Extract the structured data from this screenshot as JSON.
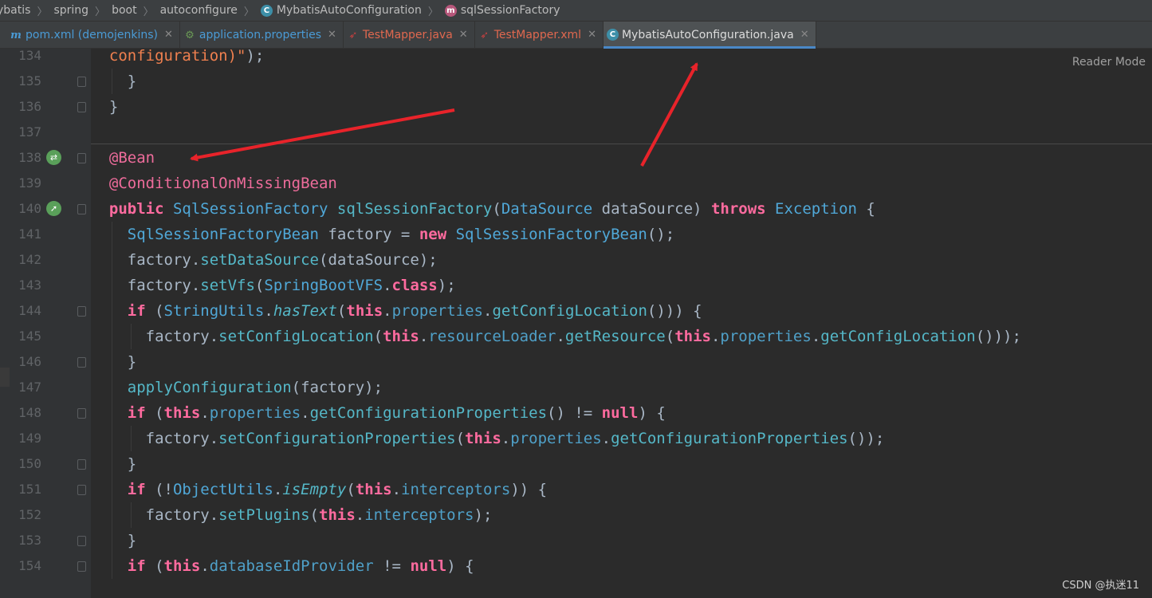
{
  "breadcrumb": {
    "items": [
      "ybatis",
      "spring",
      "boot",
      "autoconfigure",
      "MybatisAutoConfiguration",
      "sqlSessionFactory"
    ]
  },
  "tabs": [
    {
      "label": "pom.xml (demojenkins)",
      "icon": "maven-icon",
      "color": "#4a9bd6"
    },
    {
      "label": "application.properties",
      "icon": "spring-properties-icon",
      "color": "#4a9bd6"
    },
    {
      "label": "TestMapper.java",
      "icon": "mybatis-mapper-icon",
      "color": "#e0684f"
    },
    {
      "label": "TestMapper.xml",
      "icon": "mybatis-mapper-icon",
      "color": "#e0684f"
    },
    {
      "label": "MybatisAutoConfiguration.java",
      "icon": "class-icon",
      "color": "#dcdcdc",
      "active": true
    }
  ],
  "editor": {
    "reader_mode": "Reader Mode",
    "watermark": "CSDN @执迷11",
    "line_numbers": [
      "134",
      "135",
      "136",
      "137",
      "138",
      "139",
      "140",
      "141",
      "142",
      "143",
      "144",
      "145",
      "146",
      "147",
      "148",
      "149",
      "150",
      "151",
      "152",
      "153",
      "154"
    ]
  },
  "colors": {
    "background": "#2b2b2b",
    "keyword": "#ff6b9f",
    "annotation": "#ee6c9b",
    "arrow": "#e8232a",
    "active_tab_underline": "#4a88c7"
  }
}
